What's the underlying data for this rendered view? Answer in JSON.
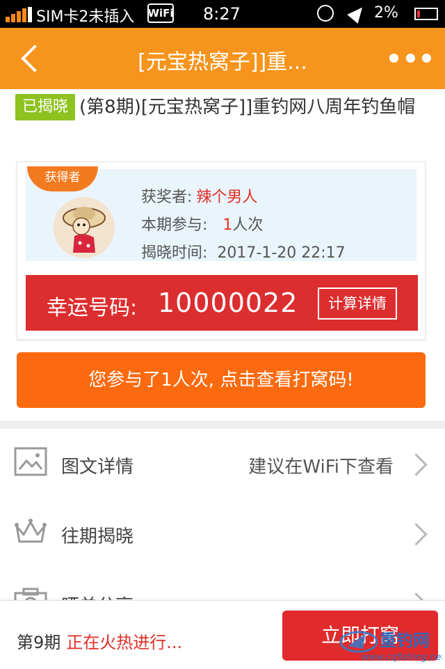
{
  "status_bar": {
    "carrier": "SIM卡2未插入",
    "wifi_label": "WiFi",
    "time": "8:27",
    "battery_percent": "2%"
  },
  "header": {
    "title": "[元宝热窝子]]重..."
  },
  "product": {
    "badge": "已揭晓",
    "title": "(第8期)[元宝热窝子]]重钓网八周年钓鱼帽"
  },
  "winner": {
    "ribbon": "获得者",
    "winner_label": "获奖者:",
    "winner_name": "辣个男人",
    "participation_label": "本期参与:",
    "participation_count": "1",
    "participation_unit": "人次",
    "reveal_time_label": "揭晓时间:",
    "reveal_time": "2017-1-20 22:17"
  },
  "lucky": {
    "label": "幸运号码:",
    "number": "10000022",
    "calc_button": "计算详情"
  },
  "participate_button": "您参与了1人次, 点击查看打窝码!",
  "menu": {
    "items": [
      {
        "label": "图文详情",
        "hint": "建议在WiFi下查看",
        "icon": "image-icon"
      },
      {
        "label": "往期揭晓",
        "hint": "",
        "icon": "crown-icon"
      },
      {
        "label": "晒单分享",
        "hint": "",
        "icon": "camera-icon"
      }
    ]
  },
  "bottom_bar": {
    "period": "第9期",
    "status": "正在火热进行...",
    "join_button": "立即打窝"
  },
  "watermark": {
    "text": "重钓网",
    "url": "www.cqfishing.net"
  },
  "colors": {
    "header": "#f7941d",
    "badge": "#8dc21f",
    "lucky_bar": "#dd2e2f",
    "participate_button": "#fb6a0f",
    "join_button": "#e12a2c",
    "accent_red": "#e02e24"
  }
}
